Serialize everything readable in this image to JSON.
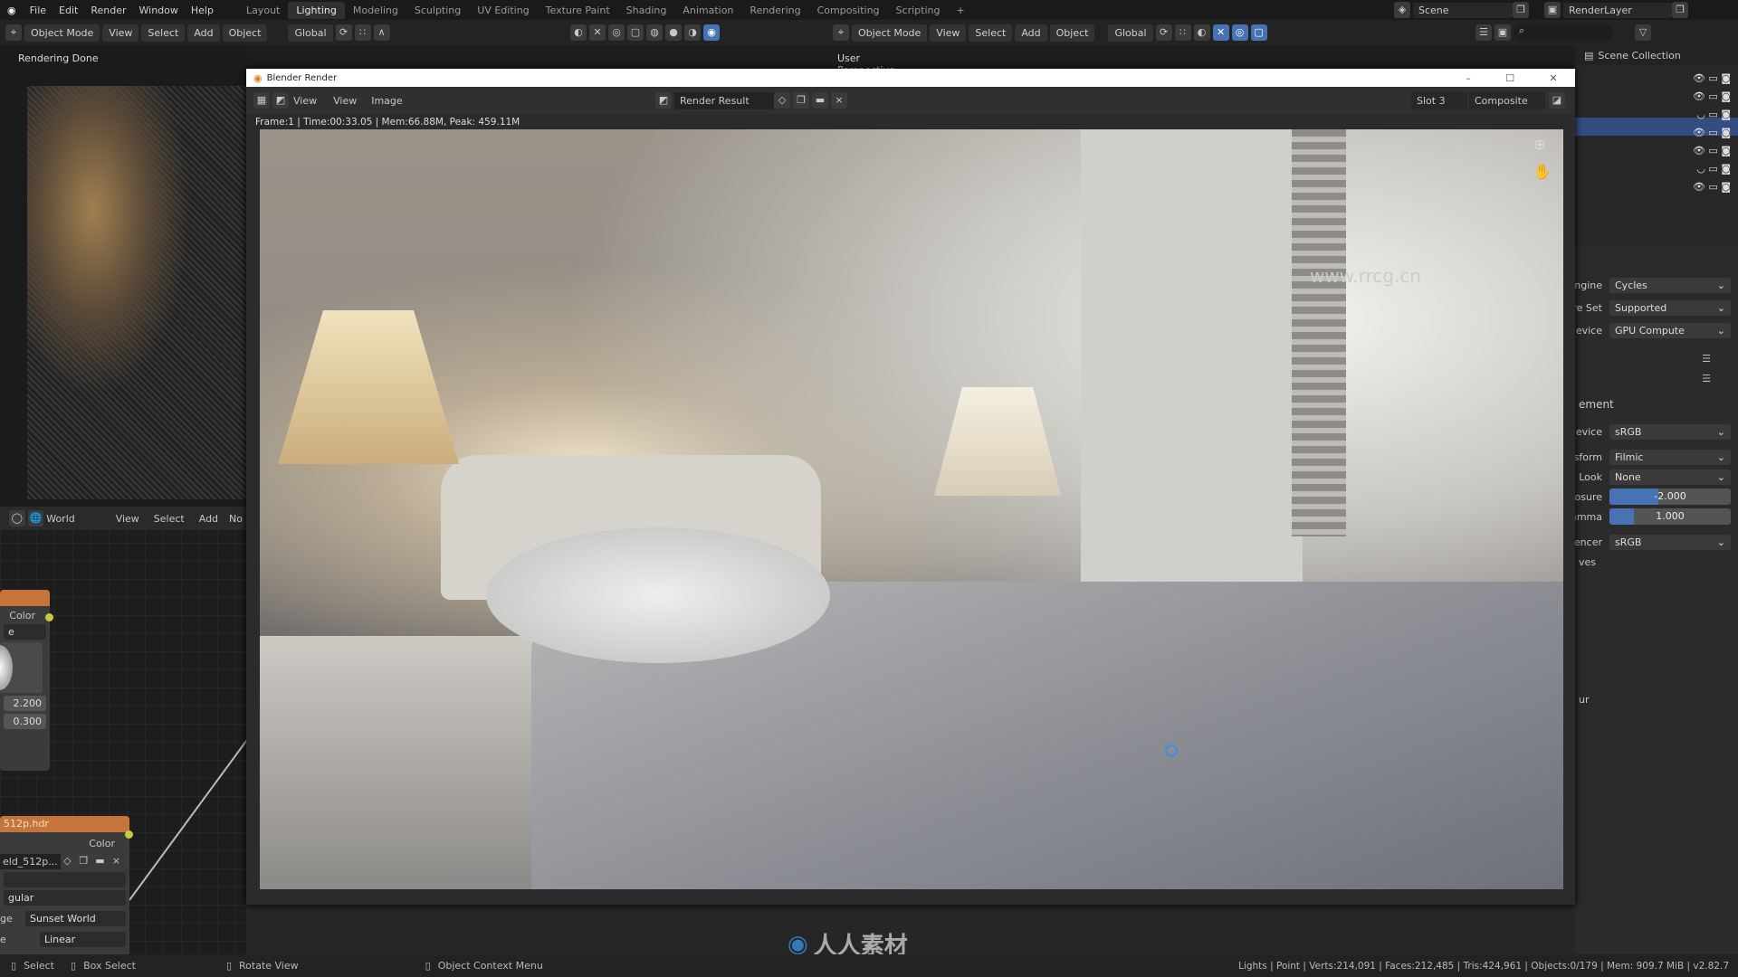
{
  "menu": {
    "items": [
      "File",
      "Edit",
      "Render",
      "Window",
      "Help"
    ]
  },
  "workspaces": {
    "tabs": [
      "Layout",
      "Lighting",
      "Modeling",
      "Sculpting",
      "UV Editing",
      "Texture Paint",
      "Shading",
      "Animation",
      "Rendering",
      "Compositing",
      "Scripting"
    ],
    "active": "Lighting",
    "add": "+"
  },
  "scene": {
    "name": "Scene",
    "render_layer": "RenderLayer"
  },
  "toolbar": {
    "mode": "Object Mode",
    "view": "View",
    "select": "Select",
    "add": "Add",
    "object": "Object",
    "orientation": "Global"
  },
  "viewport_left": {
    "status": "Rendering Done"
  },
  "viewport_right": {
    "label": "User Perspective",
    "mode": "Object Mode",
    "view": "View",
    "select": "Select",
    "add": "Add",
    "object": "Object",
    "orientation": "Global"
  },
  "outliner": {
    "title": "Scene Collection"
  },
  "node_editor": {
    "world": "World",
    "view": "View",
    "select": "Select",
    "add": "Add",
    "node": "No",
    "node1": {
      "output": "Color",
      "dropdown": "e",
      "val1": "2.200",
      "val2": "0.300"
    },
    "node2": {
      "title": "512p.hdr",
      "output": "Color",
      "image": "eld_512p...",
      "dd1": "",
      "dd2": "gular",
      "dd3_label": "ge",
      "dd3": "Sunset World",
      "dd4_label": "e",
      "dd4": "Linear"
    }
  },
  "render_window": {
    "title": "Blender Render",
    "view_menu": "View",
    "view": "View",
    "image": "Image",
    "result": "Render Result",
    "slot": "Slot 3",
    "pass": "Composite",
    "info": "Frame:1 | Time:00:33.05 | Mem:66.88M, Peak: 459.11M"
  },
  "properties": {
    "rows": [
      {
        "label": "Engine",
        "value": "Cycles"
      },
      {
        "label": "ure Set",
        "value": "Supported"
      },
      {
        "label": "Device",
        "value": "GPU Compute"
      }
    ],
    "section": "ement",
    "color": [
      {
        "label": "Device",
        "value": "sRGB"
      },
      {
        "label": "nsform",
        "value": "Filmic"
      },
      {
        "label": "Look",
        "value": "None"
      }
    ],
    "exposure": {
      "label": "posure",
      "value": "-2.000",
      "fraction": 0.4
    },
    "gamma": {
      "label": "Gamma",
      "value": "1.000",
      "fraction": 0.2
    },
    "sequencer": {
      "label": "uencer",
      "value": "sRGB"
    },
    "curves": "ves",
    "ur": "ur"
  },
  "statusbar": {
    "select": "Select",
    "box_select": "Box Select",
    "rotate": "Rotate View",
    "context": "Object Context Menu",
    "stats": "Lights | Point | Verts:214,091 | Faces:212,485 | Tris:424,961 | Objects:0/179 | Mem: 909.7 MiB | v2.82.7"
  },
  "watermark": {
    "text": "人人素材",
    "url": "www.rrcg.cn"
  },
  "colors": {
    "accent": "#4772b3",
    "node_header": "#c5743a",
    "socket": "#c9c93e"
  }
}
